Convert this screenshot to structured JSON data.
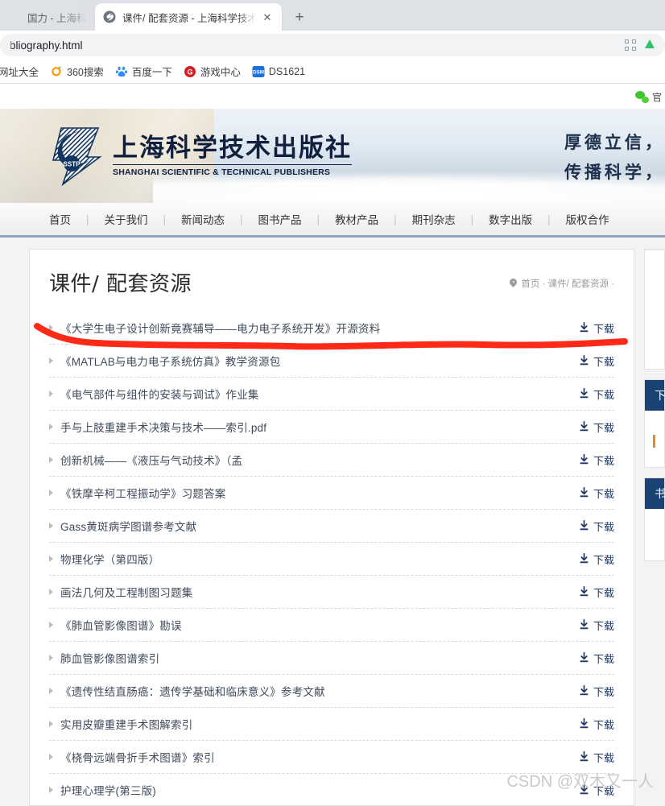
{
  "browser": {
    "tabs": [
      {
        "title": "国力 - 上海科学技",
        "active": false
      },
      {
        "title": "课件/ 配套资源 - 上海科学技术",
        "active": true
      }
    ],
    "new_tab_label": "+",
    "close_label": "✕",
    "omnibox": {
      "url": "bliography.html",
      "qr_icon": "qr-code-icon"
    },
    "bookmarks": [
      {
        "label": "网址大全",
        "icon": "partial-bookmark-icon",
        "color": "#ffffff"
      },
      {
        "label": "360搜索",
        "icon": "360-search-icon",
        "color": "#ff9500"
      },
      {
        "label": "百度一下",
        "icon": "baidu-icon",
        "color": "#2b8cff"
      },
      {
        "label": "游戏中心",
        "icon": "game-center-icon",
        "color": "#d81e22"
      },
      {
        "label": "DS1621",
        "icon": "synology-dsm-icon",
        "color": "#1e6fd9"
      }
    ]
  },
  "site": {
    "topbar": {
      "wechat_label": "官",
      "wechat_icon": "wechat-icon"
    },
    "banner": {
      "logo_cn": "上海科学技术出版社",
      "logo_en": "SHANGHAI SCIENTIFIC & TECHNICAL PUBLISHERS",
      "logo_mark": "sstp-logo-icon",
      "slogan_line1": "厚德立信，",
      "slogan_line2": "传播科学，"
    },
    "nav": [
      "首页",
      "关于我们",
      "新闻动态",
      "图书产品",
      "教材产品",
      "期刊杂志",
      "数字出版",
      "版权合作"
    ],
    "nav_separator": "|"
  },
  "main": {
    "title": "课件/ 配套资源",
    "breadcrumb": "首页 · 课件/ 配套资源 ·",
    "breadcrumb_icon": "location-pin-icon",
    "download_label": "下载",
    "download_icon": "download-icon",
    "caret_icon": "caret-right-icon",
    "items": [
      {
        "name": "《大学生电子设计创新竟赛辅导——电力电子系统开发》开源资料"
      },
      {
        "name": "《MATLAB与电力电子系统仿真》教学资源包"
      },
      {
        "name": "《电气部件与组件的安装与调试》作业集"
      },
      {
        "name": "手与上肢重建手术决策与技术——索引.pdf"
      },
      {
        "name": "创新机械——《液压与气动技术》（孟"
      },
      {
        "name": "《铁摩辛柯工程振动学》习题答案"
      },
      {
        "name": "Gass黄斑病学图谱参考文献"
      },
      {
        "name": "物理化学（第四版）"
      },
      {
        "name": "画法几何及工程制图习题集"
      },
      {
        "name": "《肺血管影像图谱》勘误"
      },
      {
        "name": "肺血管影像图谱索引"
      },
      {
        "name": "《遗传性结直肠癌：遗传学基础和临床意义》参考文献"
      },
      {
        "name": "实用皮瓣重建手术图解索引"
      },
      {
        "name": "《桡骨远端骨折手术图谱》索引"
      },
      {
        "name": "护理心理学(第三版)"
      }
    ]
  },
  "sidebar": {
    "boxes": [
      {
        "header": ""
      },
      {
        "header": "下"
      },
      {
        "header": "书"
      }
    ]
  },
  "annotation": {
    "underline_color": "#fc2a16",
    "watermark": "CSDN @双木又一人"
  }
}
